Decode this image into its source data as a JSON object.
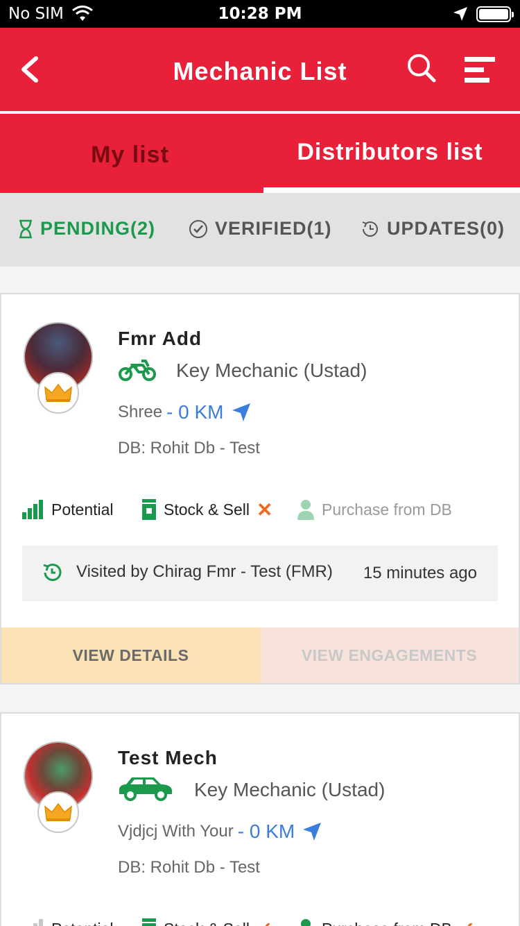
{
  "status_bar": {
    "carrier": "No SIM",
    "time": "10:28 PM"
  },
  "app_bar": {
    "title": "Mechanic List"
  },
  "tabs": [
    {
      "label": "My list",
      "selected": false
    },
    {
      "label": "Distributors list",
      "selected": true
    }
  ],
  "filters": [
    {
      "label": "PENDING(2)",
      "active": true
    },
    {
      "label": "VERIFIED(1)",
      "active": false
    },
    {
      "label": "UPDATES(0)",
      "active": false
    }
  ],
  "cards": [
    {
      "name": "Fmr Add",
      "vehicle": "motorbike-icon",
      "type": "Key Mechanic (Ustad)",
      "location": "Shree",
      "distance": "- 0 KM",
      "db": "DB: Rohit Db - Test",
      "stats": {
        "potential": "Potential",
        "stock": "Stock & Sell",
        "stock_mark": "✕",
        "purchase": "Purchase from DB"
      },
      "visited": "Visited by Chirag Fmr - Test (FMR)",
      "ago": "15 minutes ago",
      "actions": {
        "details": "VIEW DETAILS",
        "engagements": "VIEW ENGAGEMENTS"
      }
    },
    {
      "name": "Test Mech",
      "vehicle": "car-icon",
      "type": "Key Mechanic (Ustad)",
      "location": "Vjdjcj With Your",
      "distance": "- 0 KM",
      "db": "DB: Rohit Db - Test",
      "stats": {
        "potential": "Potential",
        "stock": "Stock & Sell",
        "stock_mark": "✓",
        "purchase": "Purchase from DB",
        "purchase_mark": "✓"
      }
    }
  ],
  "colors": {
    "primary": "#e8203a",
    "accent_green": "#1b9a4e",
    "link_blue": "#3b7ddd",
    "warn_orange": "#f06a1c"
  }
}
